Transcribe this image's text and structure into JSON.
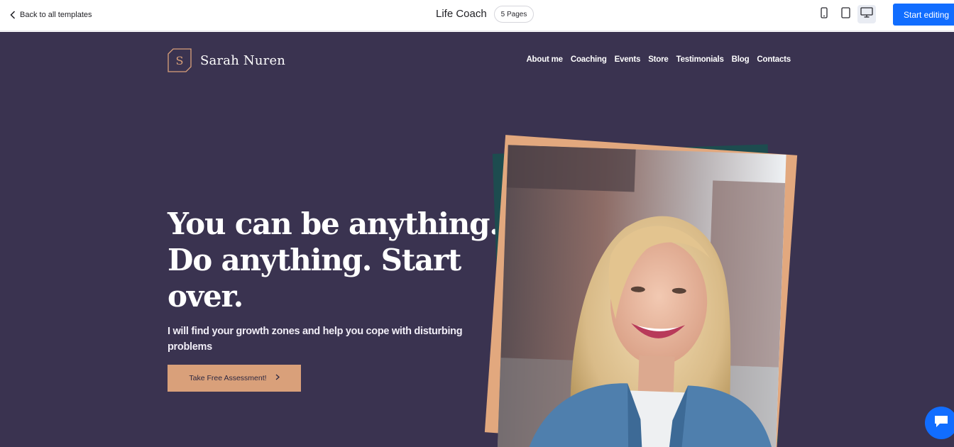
{
  "editor": {
    "back_label": "Back to all templates",
    "template_title": "Life Coach",
    "pages_badge": "5 Pages",
    "start_editing_label": "Start editing",
    "devices": [
      "mobile-icon",
      "tablet-icon",
      "desktop-icon"
    ],
    "active_device": "desktop",
    "accent_color": "#116dff"
  },
  "site": {
    "logo_letter": "S",
    "brand_name": "Sarah Nuren",
    "nav": [
      "About me",
      "Coaching",
      "Events",
      "Store",
      "Testimonials",
      "Blog",
      "Contacts"
    ],
    "headline": "You can be anything. Do anything. Start over.",
    "subtext": "I will find your growth zones and help you cope with disturbing problems",
    "cta_label": "Take Free Assessment!",
    "colors": {
      "background": "#3a3350",
      "accent": "#d9a07a",
      "frame_green": "#1d4c4f",
      "frame_tan": "#e2a87e"
    },
    "hero_image": "smiling-woman-photo"
  }
}
